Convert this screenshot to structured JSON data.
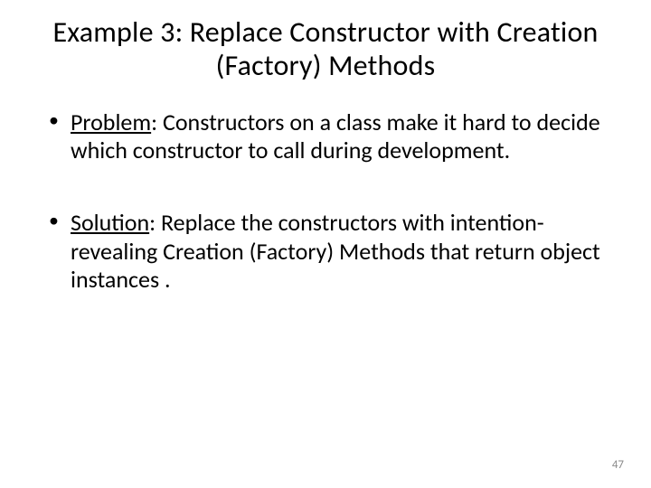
{
  "slide": {
    "title": "Example 3: Replace Constructor with Creation (Factory) Methods",
    "bullets": [
      {
        "label": "Problem",
        "text": ": Constructors on a class make it hard to decide which constructor to call during development."
      },
      {
        "label": "Solution",
        "text": ": Replace the constructors with intention-revealing Creation (Factory) Methods that return object instances ."
      }
    ],
    "page_number": "47"
  }
}
